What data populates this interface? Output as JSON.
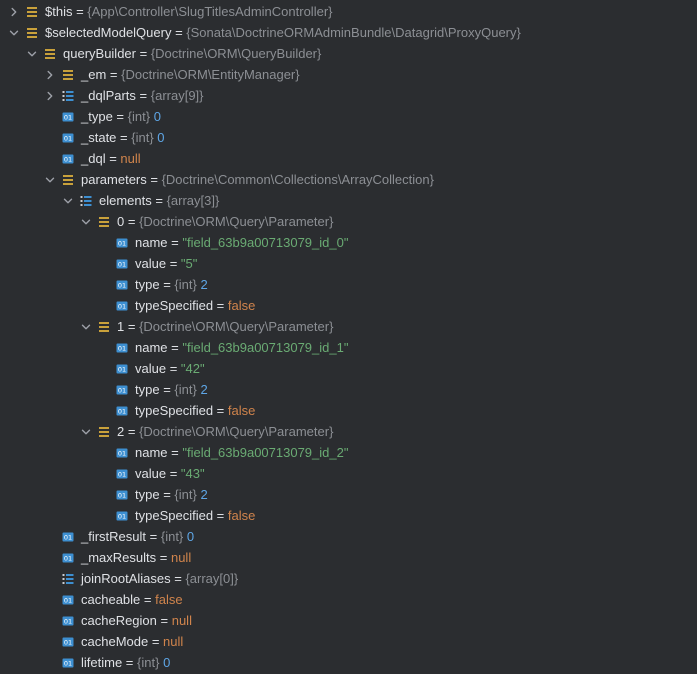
{
  "rows": [
    {
      "depth": 0,
      "expander": "collapsed",
      "icon": "object-icon",
      "name": "$this",
      "type": "{App\\Controller\\SlugTitlesAdminController}",
      "value": "",
      "value_kind": ""
    },
    {
      "depth": 0,
      "expander": "expanded",
      "icon": "object-icon",
      "name": "$selectedModelQuery",
      "type": "{Sonata\\DoctrineORMAdminBundle\\Datagrid\\ProxyQuery}",
      "value": "",
      "value_kind": ""
    },
    {
      "depth": 1,
      "expander": "expanded",
      "icon": "object-icon",
      "name": "queryBuilder",
      "type": "{Doctrine\\ORM\\QueryBuilder}",
      "value": "",
      "value_kind": ""
    },
    {
      "depth": 2,
      "expander": "collapsed",
      "icon": "object-icon",
      "name": "_em",
      "type": "{Doctrine\\ORM\\EntityManager}",
      "value": "",
      "value_kind": ""
    },
    {
      "depth": 2,
      "expander": "collapsed",
      "icon": "array-icon",
      "name": "_dqlParts",
      "type": "{array[9]}",
      "value": "",
      "value_kind": ""
    },
    {
      "depth": 2,
      "expander": "none",
      "icon": "primitive-icon",
      "name": "_type",
      "type": "{int}",
      "value": "0",
      "value_kind": "num"
    },
    {
      "depth": 2,
      "expander": "none",
      "icon": "primitive-icon",
      "name": "_state",
      "type": "{int}",
      "value": "0",
      "value_kind": "num"
    },
    {
      "depth": 2,
      "expander": "none",
      "icon": "primitive-icon",
      "name": "_dql",
      "type": "",
      "value": "null",
      "value_kind": "kw"
    },
    {
      "depth": 2,
      "expander": "expanded",
      "icon": "object-icon",
      "name": "parameters",
      "type": "{Doctrine\\Common\\Collections\\ArrayCollection}",
      "value": "",
      "value_kind": ""
    },
    {
      "depth": 3,
      "expander": "expanded",
      "icon": "array-icon",
      "name": "elements",
      "type": "{array[3]}",
      "value": "",
      "value_kind": ""
    },
    {
      "depth": 4,
      "expander": "expanded",
      "icon": "object-icon",
      "name": "0",
      "type": "{Doctrine\\ORM\\Query\\Parameter}",
      "value": "",
      "value_kind": ""
    },
    {
      "depth": 5,
      "expander": "none",
      "icon": "primitive-icon",
      "name": "name",
      "type": "",
      "value": "\"field_63b9a00713079_id_0\"",
      "value_kind": "str"
    },
    {
      "depth": 5,
      "expander": "none",
      "icon": "primitive-icon",
      "name": "value",
      "type": "",
      "value": "\"5\"",
      "value_kind": "str"
    },
    {
      "depth": 5,
      "expander": "none",
      "icon": "primitive-icon",
      "name": "type",
      "type": "{int}",
      "value": "2",
      "value_kind": "num"
    },
    {
      "depth": 5,
      "expander": "none",
      "icon": "primitive-icon",
      "name": "typeSpecified",
      "type": "",
      "value": "false",
      "value_kind": "kw"
    },
    {
      "depth": 4,
      "expander": "expanded",
      "icon": "object-icon",
      "name": "1",
      "type": "{Doctrine\\ORM\\Query\\Parameter}",
      "value": "",
      "value_kind": ""
    },
    {
      "depth": 5,
      "expander": "none",
      "icon": "primitive-icon",
      "name": "name",
      "type": "",
      "value": "\"field_63b9a00713079_id_1\"",
      "value_kind": "str"
    },
    {
      "depth": 5,
      "expander": "none",
      "icon": "primitive-icon",
      "name": "value",
      "type": "",
      "value": "\"42\"",
      "value_kind": "str"
    },
    {
      "depth": 5,
      "expander": "none",
      "icon": "primitive-icon",
      "name": "type",
      "type": "{int}",
      "value": "2",
      "value_kind": "num"
    },
    {
      "depth": 5,
      "expander": "none",
      "icon": "primitive-icon",
      "name": "typeSpecified",
      "type": "",
      "value": "false",
      "value_kind": "kw"
    },
    {
      "depth": 4,
      "expander": "expanded",
      "icon": "object-icon",
      "name": "2",
      "type": "{Doctrine\\ORM\\Query\\Parameter}",
      "value": "",
      "value_kind": ""
    },
    {
      "depth": 5,
      "expander": "none",
      "icon": "primitive-icon",
      "name": "name",
      "type": "",
      "value": "\"field_63b9a00713079_id_2\"",
      "value_kind": "str"
    },
    {
      "depth": 5,
      "expander": "none",
      "icon": "primitive-icon",
      "name": "value",
      "type": "",
      "value": "\"43\"",
      "value_kind": "str"
    },
    {
      "depth": 5,
      "expander": "none",
      "icon": "primitive-icon",
      "name": "type",
      "type": "{int}",
      "value": "2",
      "value_kind": "num"
    },
    {
      "depth": 5,
      "expander": "none",
      "icon": "primitive-icon",
      "name": "typeSpecified",
      "type": "",
      "value": "false",
      "value_kind": "kw"
    },
    {
      "depth": 2,
      "expander": "none",
      "icon": "primitive-icon",
      "name": "_firstResult",
      "type": "{int}",
      "value": "0",
      "value_kind": "num"
    },
    {
      "depth": 2,
      "expander": "none",
      "icon": "primitive-icon",
      "name": "_maxResults",
      "type": "",
      "value": "null",
      "value_kind": "kw"
    },
    {
      "depth": 2,
      "expander": "none",
      "icon": "array-icon",
      "name": "joinRootAliases",
      "type": "{array[0]}",
      "value": "",
      "value_kind": ""
    },
    {
      "depth": 2,
      "expander": "none",
      "icon": "primitive-icon",
      "name": "cacheable",
      "type": "",
      "value": "false",
      "value_kind": "kw"
    },
    {
      "depth": 2,
      "expander": "none",
      "icon": "primitive-icon",
      "name": "cacheRegion",
      "type": "",
      "value": "null",
      "value_kind": "kw"
    },
    {
      "depth": 2,
      "expander": "none",
      "icon": "primitive-icon",
      "name": "cacheMode",
      "type": "",
      "value": "null",
      "value_kind": "kw"
    },
    {
      "depth": 2,
      "expander": "none",
      "icon": "primitive-icon",
      "name": "lifetime",
      "type": "{int}",
      "value": "0",
      "value_kind": "num"
    }
  ],
  "colors": {
    "background": "#2b2d30",
    "text": "#dfe1e5",
    "type": "#8c8f94",
    "number": "#5ea6e6",
    "keyword": "#d0844c",
    "string": "#6aab73",
    "object_icon": "#c9a13b",
    "primitive_icon": "#3d8fd1"
  }
}
